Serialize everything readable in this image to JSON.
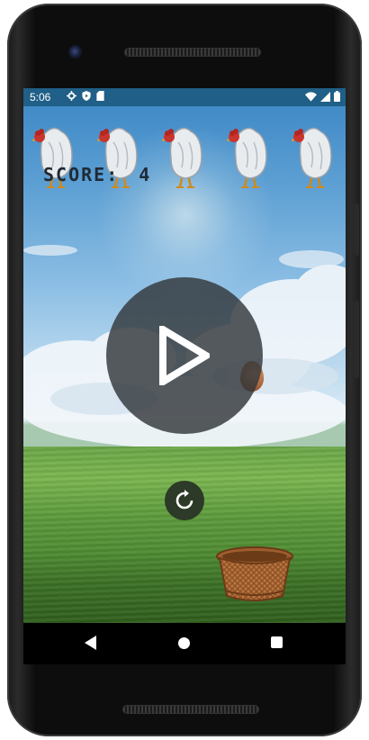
{
  "status_bar": {
    "time": "5:06",
    "left_icons": [
      "gear-icon",
      "play-protect-icon",
      "sd-card-icon"
    ],
    "right_icons": [
      "wifi-icon",
      "signal-icon",
      "battery-icon"
    ]
  },
  "game": {
    "score_label": "SCORE:",
    "score_value": "4",
    "hen_count": 5,
    "play_icon": "play-icon",
    "restart_icon": "restart-icon"
  },
  "colors": {
    "status_bar": "#205f87",
    "overlay": "#32373a",
    "restart_bg": "#2d3a27",
    "score_text": "#1f2a36"
  },
  "nav_bar": {
    "buttons": [
      "back-icon",
      "home-icon",
      "recents-icon"
    ]
  }
}
